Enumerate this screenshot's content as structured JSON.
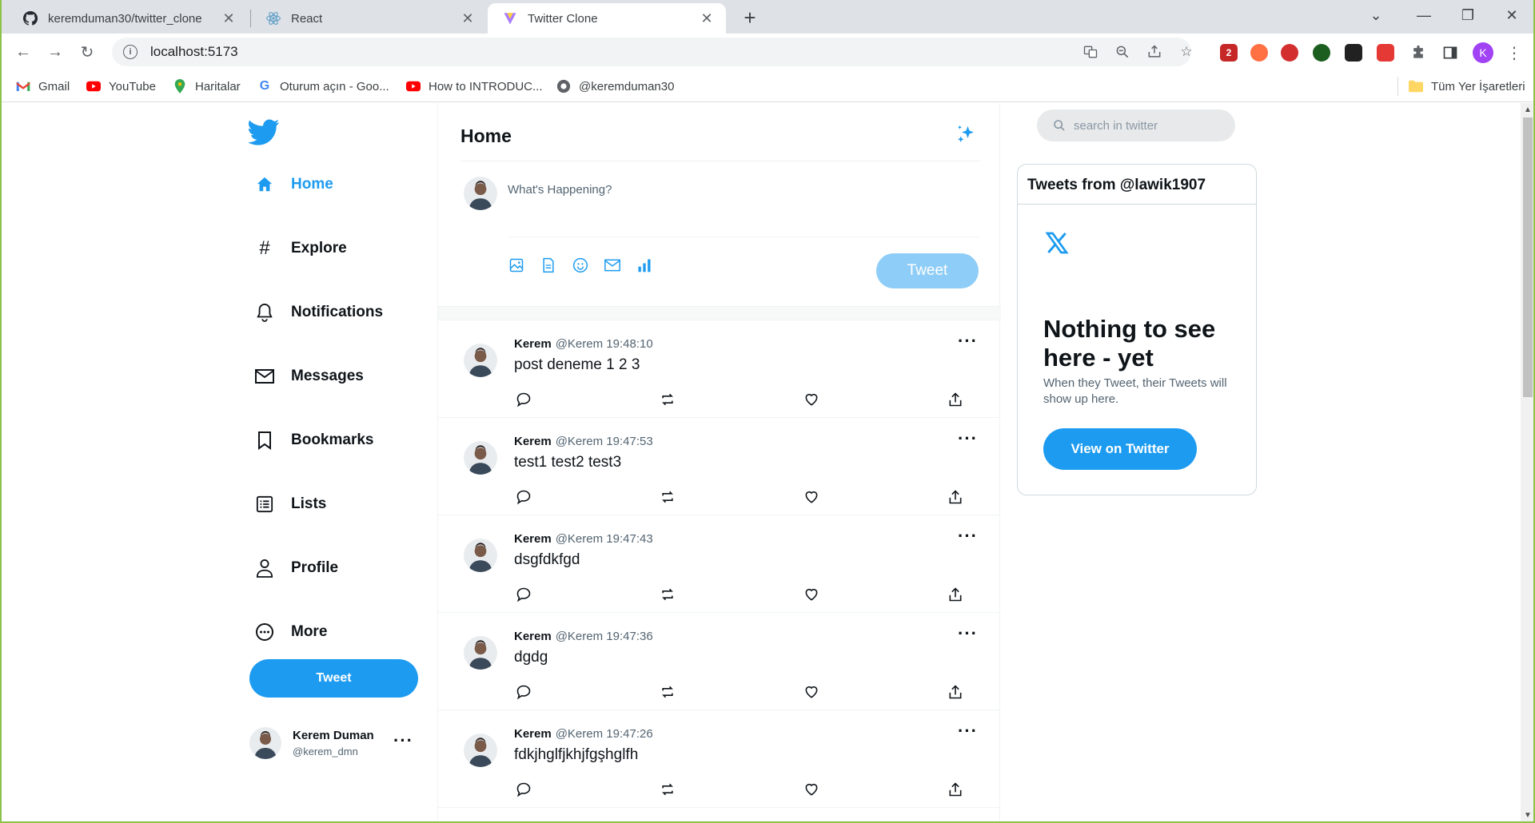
{
  "browser": {
    "tabs": [
      {
        "title": "keremduman30/twitter_clone",
        "icon": "github-icon"
      },
      {
        "title": "React",
        "icon": "react-icon"
      },
      {
        "title": "Twitter Clone",
        "icon": "vite-icon"
      }
    ],
    "url": "localhost:5173",
    "profile_initial": "K",
    "extension_badge": "2",
    "bookmarks": [
      {
        "label": "Gmail",
        "icon": "gmail-icon"
      },
      {
        "label": "YouTube",
        "icon": "youtube-icon"
      },
      {
        "label": "Haritalar",
        "icon": "maps-icon"
      },
      {
        "label": "Oturum açın - Goo...",
        "icon": "google-icon"
      },
      {
        "label": "How to INTRODUC...",
        "icon": "youtube-icon"
      },
      {
        "label": "@keremduman30",
        "icon": "globe-icon"
      }
    ],
    "all_bookmarks_label": "Tüm Yer İşaretleri"
  },
  "sidebar": {
    "nav": [
      {
        "label": "Home",
        "icon": "home-icon",
        "active": true
      },
      {
        "label": "Explore",
        "icon": "hashtag-icon"
      },
      {
        "label": "Notifications",
        "icon": "bell-icon"
      },
      {
        "label": "Messages",
        "icon": "envelope-icon"
      },
      {
        "label": "Bookmarks",
        "icon": "bookmark-icon"
      },
      {
        "label": "Lists",
        "icon": "list-icon"
      },
      {
        "label": "Profile",
        "icon": "user-icon"
      },
      {
        "label": "More",
        "icon": "more-circle-icon"
      }
    ],
    "tweet_button": "Tweet",
    "user": {
      "name": "Kerem Duman",
      "handle": "@kerem_dmn",
      "menu": "···"
    }
  },
  "main": {
    "title": "Home",
    "composer": {
      "placeholder": "What's Happening?",
      "tools": [
        "image-icon",
        "document-icon",
        "emoji-icon",
        "mail-icon",
        "poll-icon"
      ],
      "tweet_button": "Tweet"
    },
    "posts": [
      {
        "name": "Kerem",
        "handle": "@Kerem",
        "time": "19:48:10",
        "text": "post deneme 1 2 3"
      },
      {
        "name": "Kerem",
        "handle": "@Kerem",
        "time": "19:47:53",
        "text": "test1 test2 test3"
      },
      {
        "name": "Kerem",
        "handle": "@Kerem",
        "time": "19:47:43",
        "text": "dsgfdkfgd"
      },
      {
        "name": "Kerem",
        "handle": "@Kerem",
        "time": "19:47:36",
        "text": "dgdg"
      },
      {
        "name": "Kerem",
        "handle": "@Kerem",
        "time": "19:47:26",
        "text": "fdkjhglfjkhjfgşhglfh"
      }
    ],
    "post_menu": "···"
  },
  "right": {
    "search_placeholder": "search in twitter",
    "embed": {
      "header": "Tweets from @lawik1907",
      "headline": "Nothing to see here - yet",
      "subtext": "When they Tweet, their Tweets will show up here.",
      "button": "View on Twitter"
    }
  },
  "colors": {
    "accent": "#1d9bf0",
    "accent_disabled": "#8ecdf7",
    "text": "#0f1419",
    "muted": "#536471"
  }
}
